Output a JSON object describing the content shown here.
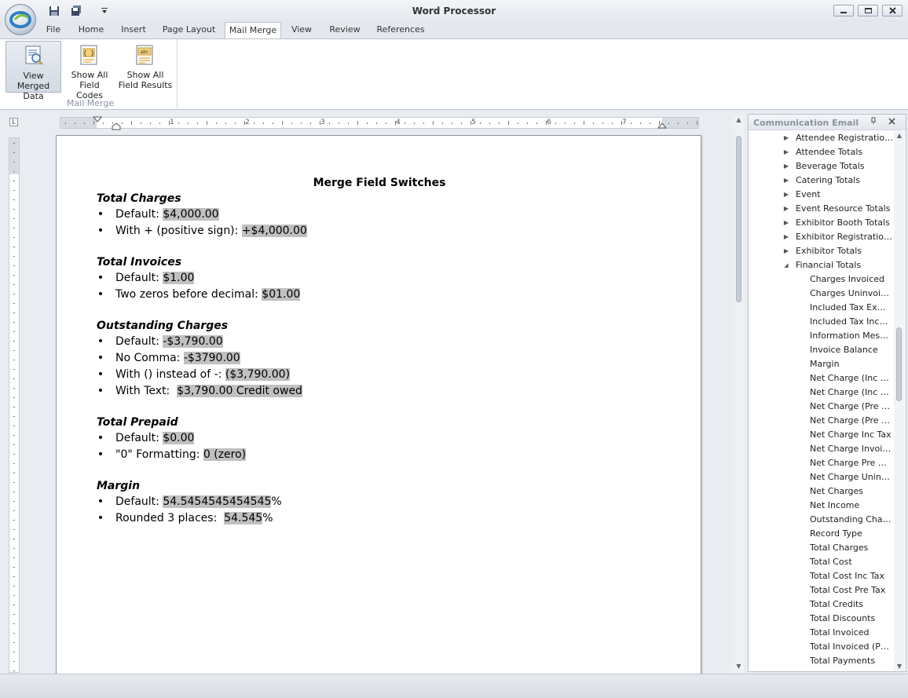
{
  "window": {
    "title": "Word Processor"
  },
  "ribbon": {
    "tabs": [
      {
        "label": "File"
      },
      {
        "label": "Home"
      },
      {
        "label": "Insert"
      },
      {
        "label": "Page Layout"
      },
      {
        "label": "Mail Merge",
        "active": true
      },
      {
        "label": "View"
      },
      {
        "label": "Review"
      },
      {
        "label": "References"
      }
    ],
    "mail_merge_group": {
      "label": "Mail Merge",
      "buttons": [
        {
          "line1": "View Merged",
          "line2": "Data",
          "icon": "view-merged-data-icon",
          "selected": true
        },
        {
          "line1": "Show All",
          "line2": "Field Codes",
          "icon": "field-codes-icon",
          "selected": false
        },
        {
          "line1": "Show All",
          "line2": "Field Results",
          "icon": "field-results-icon",
          "selected": false
        }
      ]
    }
  },
  "ruler": {
    "corner": "L",
    "numbers": [
      "1",
      "2",
      "3",
      "4",
      "5",
      "6",
      "7"
    ]
  },
  "document": {
    "title": "Merge Field Switches",
    "sections": [
      {
        "heading": "Total Charges",
        "items": [
          {
            "label": "Default: ",
            "value": "$4,000.00",
            "suffix": ""
          },
          {
            "label": "With + (positive sign): ",
            "value": "+$4,000.00",
            "suffix": ""
          }
        ]
      },
      {
        "heading": "Total Invoices",
        "items": [
          {
            "label": "Default: ",
            "value": "$1.00",
            "suffix": ""
          },
          {
            "label": "Two zeros before decimal: ",
            "value": "$01.00",
            "suffix": ""
          }
        ]
      },
      {
        "heading": "Outstanding Charges",
        "items": [
          {
            "label": "Default: ",
            "value": "-$3,790.00",
            "suffix": ""
          },
          {
            "label": "No Comma: ",
            "value": "-$3790.00",
            "suffix": ""
          },
          {
            "label": "With () instead of -: ",
            "value": "($3,790.00)",
            "suffix": ""
          },
          {
            "label": "With Text:  ",
            "value": "$3,790.00 Credit owed",
            "suffix": ""
          }
        ]
      },
      {
        "heading": "Total Prepaid",
        "items": [
          {
            "label": "Default: ",
            "value": "$0.00",
            "suffix": ""
          },
          {
            "label": "\"0\" Formatting: ",
            "value": "0 (zero)",
            "suffix": ""
          }
        ]
      },
      {
        "heading": "Margin",
        "items": [
          {
            "label": "Default: ",
            "value": "54.5454545454545",
            "suffix": "%"
          },
          {
            "label": "Rounded 3 places:  ",
            "value": "54.545",
            "suffix": "%"
          }
        ]
      }
    ]
  },
  "panel": {
    "title": "Communication Email",
    "tree": [
      {
        "label": "Attendee Registratio…",
        "level": 0,
        "state": "collapsed"
      },
      {
        "label": "Attendee Totals",
        "level": 0,
        "state": "collapsed"
      },
      {
        "label": "Beverage Totals",
        "level": 0,
        "state": "collapsed"
      },
      {
        "label": "Catering Totals",
        "level": 0,
        "state": "collapsed"
      },
      {
        "label": "Event",
        "level": 0,
        "state": "collapsed"
      },
      {
        "label": "Event Resource Totals",
        "level": 0,
        "state": "collapsed"
      },
      {
        "label": "Exhibitor Booth Totals",
        "level": 0,
        "state": "collapsed"
      },
      {
        "label": "Exhibitor Registratio…",
        "level": 0,
        "state": "collapsed"
      },
      {
        "label": "Exhibitor Totals",
        "level": 0,
        "state": "collapsed"
      },
      {
        "label": "Financial Totals",
        "level": 0,
        "state": "expanded"
      },
      {
        "label": "Charges Invoiced",
        "level": 1
      },
      {
        "label": "Charges Uninvoi…",
        "level": 1
      },
      {
        "label": "Included Tax Ex…",
        "level": 1
      },
      {
        "label": "Included Tax Inc…",
        "level": 1
      },
      {
        "label": "Information Mes…",
        "level": 1
      },
      {
        "label": "Invoice Balance",
        "level": 1
      },
      {
        "label": "Margin",
        "level": 1
      },
      {
        "label": "Net Charge (Inc …",
        "level": 1
      },
      {
        "label": "Net Charge (Inc …",
        "level": 1
      },
      {
        "label": "Net Charge (Pre …",
        "level": 1
      },
      {
        "label": "Net Charge (Pre …",
        "level": 1
      },
      {
        "label": "Net Charge Inc Tax",
        "level": 1
      },
      {
        "label": "Net Charge Invoi…",
        "level": 1
      },
      {
        "label": "Net Charge Pre …",
        "level": 1
      },
      {
        "label": "Net Charge Unin…",
        "level": 1
      },
      {
        "label": "Net Charges",
        "level": 1
      },
      {
        "label": "Net Income",
        "level": 1
      },
      {
        "label": "Outstanding Cha…",
        "level": 1
      },
      {
        "label": "Record Type",
        "level": 1
      },
      {
        "label": "Total Charges",
        "level": 1
      },
      {
        "label": "Total Cost",
        "level": 1
      },
      {
        "label": "Total Cost Inc Tax",
        "level": 1
      },
      {
        "label": "Total Cost Pre Tax",
        "level": 1
      },
      {
        "label": "Total Credits",
        "level": 1
      },
      {
        "label": "Total Discounts",
        "level": 1
      },
      {
        "label": "Total Invoiced",
        "level": 1
      },
      {
        "label": "Total Invoiced (P…",
        "level": 1
      },
      {
        "label": "Total Payments",
        "level": 1
      }
    ]
  },
  "colors": {
    "field_highlight": "#c0c0c0",
    "panel_title": "#8a94a0"
  }
}
